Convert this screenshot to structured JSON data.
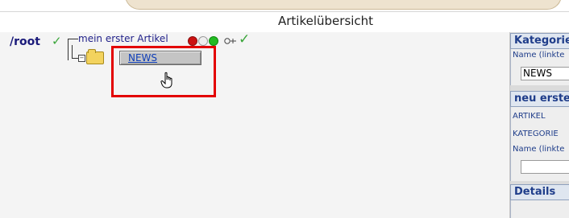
{
  "header": {
    "title": "Artikelübersicht"
  },
  "tree": {
    "root_label": "/root",
    "article_label": "mein erster Artikel",
    "context_item_label": "NEWS"
  },
  "right_panel": {
    "category_header": "Kategorie",
    "category_name_label": "Name (linkte",
    "category_name_value": "NEWS",
    "article_header": "neu erste",
    "artikel_label": "ARTIKEL",
    "kategorie_label": "KATEGORIE",
    "article_name_label": "Name (linkte",
    "article_name_value": "",
    "details_header": "Details"
  },
  "colors": {
    "highlight_border": "#e30000",
    "link_blue": "#0f3eb8",
    "panel_header_text": "#1f3d8a"
  },
  "icons": {
    "root_check": "check-icon",
    "article_check": "check-icon",
    "status_lights": [
      "red",
      "grey",
      "green"
    ],
    "move": "move-icon",
    "folder": "folder-icon",
    "cursor": "hand-pointer-icon"
  }
}
